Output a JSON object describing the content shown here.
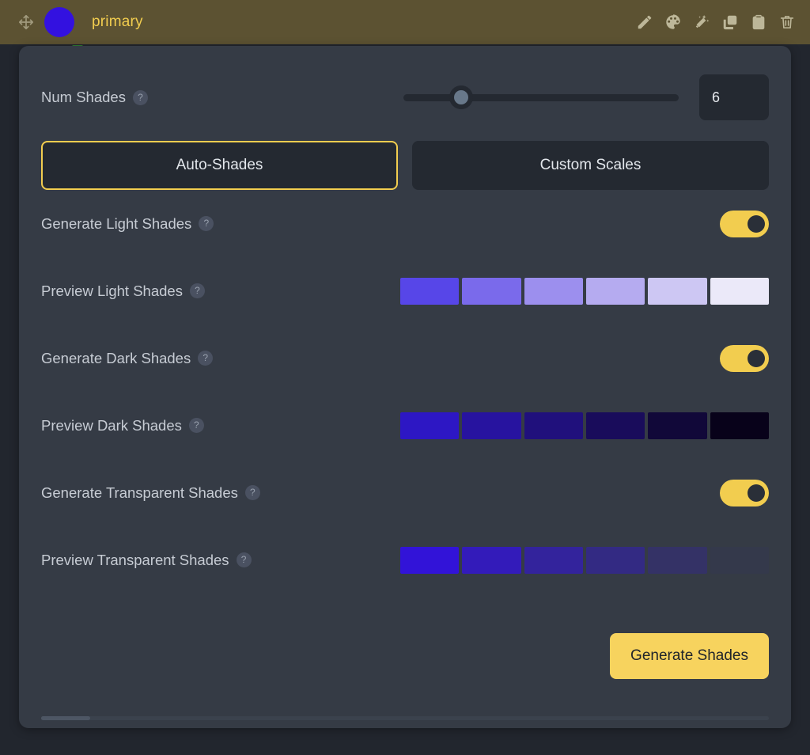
{
  "header": {
    "title": "primary",
    "color_dot": "#3311e0",
    "bar_background": "#5c5232",
    "title_color": "#f2cd4f",
    "drag_icon": "move-icon",
    "actions": [
      {
        "name": "edit-icon",
        "label": "Edit"
      },
      {
        "name": "palette-icon",
        "label": "Palette"
      },
      {
        "name": "magic-wand-icon",
        "label": "Magic"
      },
      {
        "name": "duplicate-icon",
        "label": "Duplicate"
      },
      {
        "name": "clipboard-icon",
        "label": "Paste"
      },
      {
        "name": "trash-icon",
        "label": "Delete"
      }
    ]
  },
  "num_shades": {
    "label": "Num Shades",
    "help": "?",
    "value": "6",
    "slider_min": 0,
    "slider_max": 20,
    "slider_value": 6,
    "slider_percent": 21
  },
  "tabs": [
    {
      "label": "Auto-Shades",
      "active": true
    },
    {
      "label": "Custom Scales",
      "active": false
    }
  ],
  "sections": {
    "light": {
      "generate_label": "Generate Light Shades",
      "generate_on": true,
      "preview_label": "Preview Light Shades",
      "swatches": [
        "#5746e8",
        "#7a6aeb",
        "#9c8fee",
        "#b5abf0",
        "#cdc7f3",
        "#ebe9f9"
      ]
    },
    "dark": {
      "generate_label": "Generate Dark Shades",
      "generate_on": true,
      "preview_label": "Preview Dark Shades",
      "swatches": [
        "#2d17c4",
        "#27139f",
        "#20107c",
        "#190c5b",
        "#110839",
        "#08021a"
      ]
    },
    "transparent": {
      "generate_label": "Generate Transparent Shades",
      "generate_on": true,
      "preview_label": "Preview Transparent Shades",
      "swatches": [
        "rgba(51,17,224,0.95)",
        "rgba(51,17,224,0.76)",
        "rgba(51,17,224,0.57)",
        "rgba(51,17,224,0.40)",
        "rgba(51,17,224,0.22)",
        "rgba(51,17,224,0.04)"
      ]
    }
  },
  "footer": {
    "generate_button": "Generate Shades"
  },
  "colors": {
    "accent": "#f2cd4f",
    "card_bg": "#353b45",
    "input_bg": "#242931",
    "page_bg": "#22262e",
    "text": "#c7ccd4"
  },
  "help_glyph": "?"
}
